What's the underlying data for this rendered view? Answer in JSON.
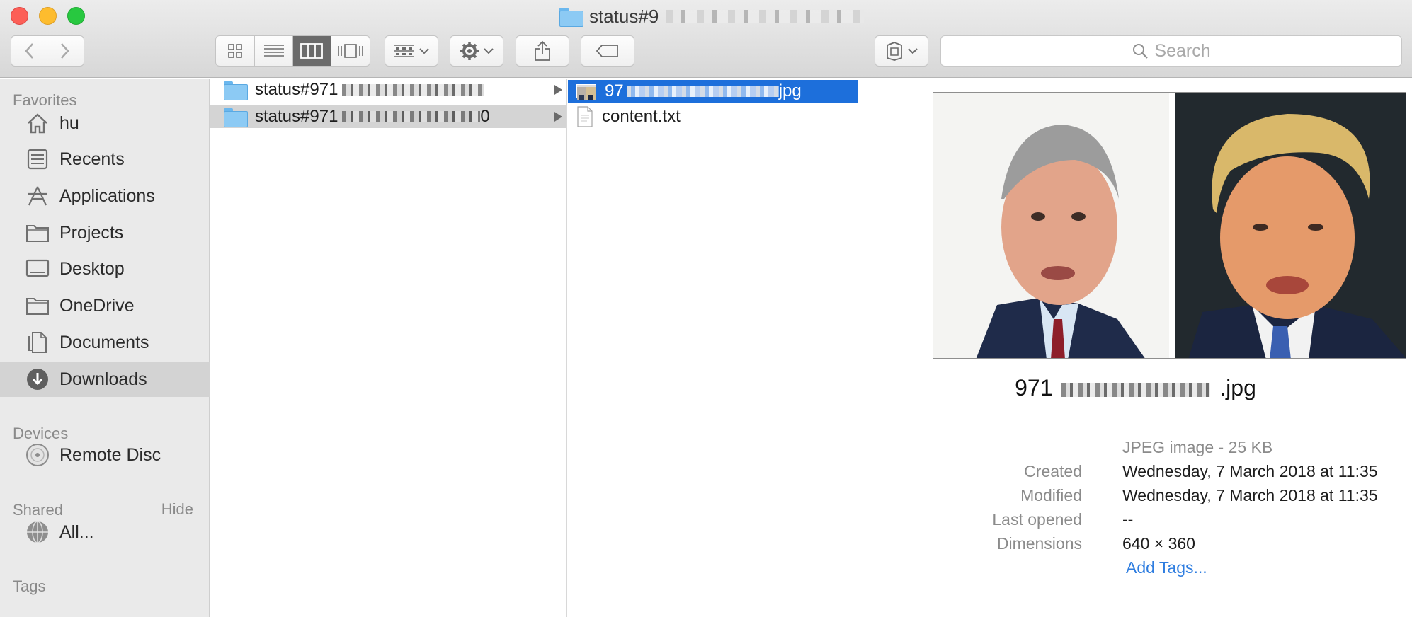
{
  "window": {
    "title_prefix": "status#9",
    "traffic_lights": [
      "close",
      "minimize",
      "zoom"
    ]
  },
  "toolbar": {
    "nav": [
      "back",
      "forward"
    ],
    "view_modes": [
      "icon-view",
      "list-view",
      "column-view",
      "gallery-view"
    ],
    "active_view": "column-view",
    "search_placeholder": "Search"
  },
  "sidebar": {
    "favorites_heading": "Favorites",
    "favorites": [
      {
        "label": "hu",
        "icon": "home-icon"
      },
      {
        "label": "Recents",
        "icon": "recents-icon"
      },
      {
        "label": "Applications",
        "icon": "applications-icon"
      },
      {
        "label": "Projects",
        "icon": "folder-icon"
      },
      {
        "label": "Desktop",
        "icon": "desktop-icon"
      },
      {
        "label": "OneDrive",
        "icon": "folder-icon"
      },
      {
        "label": "Documents",
        "icon": "documents-icon"
      },
      {
        "label": "Downloads",
        "icon": "downloads-icon",
        "selected": true
      }
    ],
    "devices_heading": "Devices",
    "devices": [
      {
        "label": "Remote Disc",
        "icon": "disc-icon"
      }
    ],
    "shared_heading": "Shared",
    "shared_hide": "Hide",
    "shared": [
      {
        "label": "All...",
        "icon": "network-icon"
      }
    ],
    "tags_heading": "Tags"
  },
  "columns": {
    "col1": [
      {
        "label": "status#971",
        "suffix": "",
        "state": "normal"
      },
      {
        "label": "status#971",
        "suffix": "0",
        "state": "gray"
      }
    ],
    "col2": [
      {
        "label": "97",
        "suffix": "jpg",
        "state": "selected"
      },
      {
        "label": "content.txt",
        "state": "normal"
      }
    ]
  },
  "preview": {
    "name_prefix": "971",
    "name_suffix": ".jpg",
    "kind": "JPEG image - 25 KB",
    "meta": [
      {
        "label": "Created",
        "value": "Wednesday, 7 March 2018 at 11:35"
      },
      {
        "label": "Modified",
        "value": "Wednesday, 7 March 2018 at 11:35"
      },
      {
        "label": "Last opened",
        "value": "--"
      },
      {
        "label": "Dimensions",
        "value": "640 × 360"
      }
    ],
    "add_tags": "Add Tags..."
  },
  "colors": {
    "selection_blue": "#1d6fdb",
    "sidebar_bg": "#eaeaea",
    "link": "#2e7de0"
  }
}
